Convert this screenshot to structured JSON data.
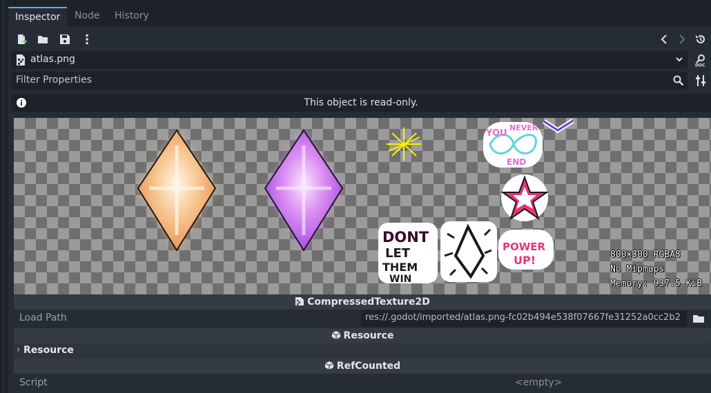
{
  "tabs": [
    {
      "label": "Inspector",
      "active": true
    },
    {
      "label": "Node",
      "active": false
    },
    {
      "label": "History",
      "active": false
    }
  ],
  "toolbar": {
    "icons": [
      "new-resource-icon",
      "open-folder-icon",
      "save-icon",
      "more-options-icon",
      "back-icon",
      "forward-icon",
      "history-icon"
    ]
  },
  "resource": {
    "name": "atlas.png",
    "icon": "image-file-icon"
  },
  "filter": {
    "placeholder": "Filter Properties"
  },
  "notice": {
    "message": "This object is read-only."
  },
  "preview": {
    "info_line1": "800×300 RGBA8",
    "info_line2": "No Mipmaps",
    "info_line3": "Memory: 937.5 KiB"
  },
  "sections": {
    "compressed_texture": "CompressedTexture2D",
    "resource": "Resource",
    "refcounted": "RefCounted"
  },
  "properties": {
    "load_path_label": "Load Path",
    "load_path_value": "res://.godot/imported/atlas.png-fc02b494e538f07667fe31252a0cc2b2",
    "resource_group": "Resource",
    "script_label": "Script",
    "script_value": "<empty>"
  },
  "colors": {
    "accent": "#6ea9e6",
    "panel_bg": "#262c35",
    "field_bg": "#1d2229"
  }
}
